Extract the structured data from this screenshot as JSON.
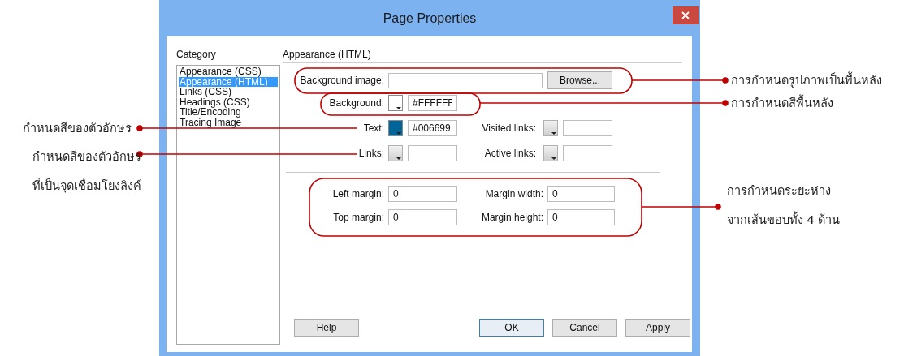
{
  "window": {
    "title": "Page Properties"
  },
  "category": {
    "label": "Category",
    "items": [
      {
        "label": "Appearance (CSS)",
        "selected": false
      },
      {
        "label": "Appearance (HTML)",
        "selected": true
      },
      {
        "label": "Links (CSS)",
        "selected": false
      },
      {
        "label": "Headings (CSS)",
        "selected": false
      },
      {
        "label": "Title/Encoding",
        "selected": false
      },
      {
        "label": "Tracing Image",
        "selected": false
      }
    ]
  },
  "panel": {
    "heading": "Appearance (HTML)",
    "background_image": {
      "label": "Background image:",
      "button": "Browse..."
    },
    "background": {
      "label": "Background:",
      "color": "#ffffff",
      "value": "#FFFFFF"
    },
    "color_rows": [
      [
        {
          "label": "Text:",
          "color": "#006699",
          "value": "#006699"
        },
        {
          "label": "Visited links:"
        }
      ],
      [
        {
          "label": "Links:"
        },
        {
          "label": "Active links:"
        }
      ]
    ],
    "margin_rows": [
      [
        {
          "label": "Left margin:",
          "value": "0"
        },
        {
          "label": "Margin width:",
          "value": "0"
        }
      ],
      [
        {
          "label": "Top margin:",
          "value": "0"
        },
        {
          "label": "Margin height:",
          "value": "0"
        }
      ]
    ]
  },
  "buttons": [
    {
      "label": "Help",
      "default": false
    },
    {
      "label": "OK",
      "default": true
    },
    {
      "label": "Cancel",
      "default": false
    },
    {
      "label": "Apply",
      "default": false
    }
  ],
  "annotations": [
    {
      "kind": "right",
      "lines": [
        "การกำหนดรูปภาพเป็นพื้นหลัง"
      ]
    },
    {
      "kind": "right",
      "lines": [
        "การกำหนดสีพื้นหลัง"
      ]
    },
    {
      "kind": "left",
      "lines": [
        "กำหนดสีของตัวอักษร"
      ]
    },
    {
      "kind": "left",
      "lines": [
        "กำหนดสีของตัวอักษร",
        "ที่เป็นจุดเชื่อมโยงลิงค์"
      ]
    },
    {
      "kind": "right",
      "lines": [
        "การกำหนดระยะห่าง",
        "จากเส้นขอบทั้ง 4 ด้าน"
      ]
    }
  ]
}
